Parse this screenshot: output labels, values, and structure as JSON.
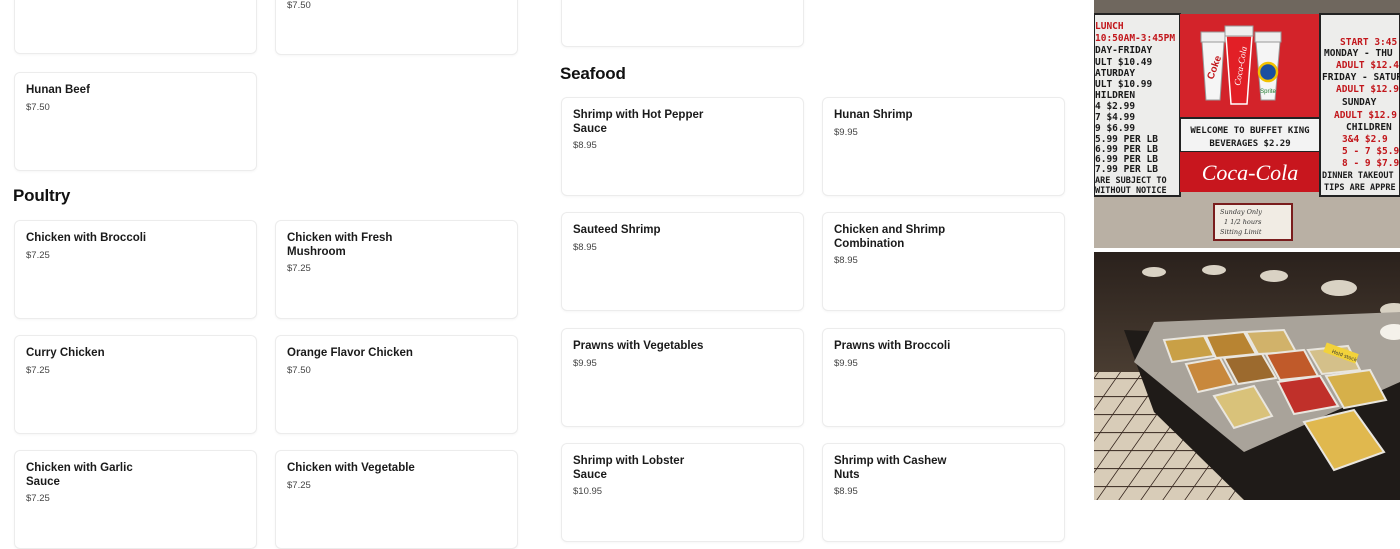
{
  "sections": {
    "poultry_title": "Poultry",
    "seafood_title": "Seafood"
  },
  "beef_items": [
    {
      "name": "",
      "price": ""
    },
    {
      "name": "",
      "price": "$7.50"
    },
    {
      "name": "Hunan Beef",
      "price": "$7.50"
    }
  ],
  "poultry_items": [
    {
      "name": "Chicken with Broccoli",
      "price": "$7.25"
    },
    {
      "name": "Chicken with Fresh Mushroom",
      "price": "$7.25"
    },
    {
      "name": "Curry Chicken",
      "price": "$7.25"
    },
    {
      "name": "Orange Flavor Chicken",
      "price": "$7.50"
    },
    {
      "name": "Chicken with Garlic Sauce",
      "price": "$7.25"
    },
    {
      "name": "Chicken with Vegetable",
      "price": "$7.25"
    }
  ],
  "seafood_items": [
    {
      "name": "Shrimp with Hot Pepper Sauce",
      "price": "$8.95"
    },
    {
      "name": "Hunan Shrimp",
      "price": "$9.95"
    },
    {
      "name": "Sauteed Shrimp",
      "price": "$8.95"
    },
    {
      "name": "Chicken and Shrimp Combination",
      "price": "$8.95"
    },
    {
      "name": "Prawns with Vegetables",
      "price": "$9.95"
    },
    {
      "name": "Prawns with Broccoli",
      "price": "$9.95"
    },
    {
      "name": "Shrimp with Lobster Sauce",
      "price": "$10.95"
    },
    {
      "name": "Shrimp with Cashew Nuts",
      "price": "$8.95"
    }
  ],
  "photos": {
    "menu_board": {
      "left_panel": [
        "LUNCH",
        "10:50AM-3:45PM",
        "DAY-FRIDAY",
        "ULT $10.49",
        "ATURDAY",
        "ULT $10.99",
        "HILDREN",
        "4 $2.99",
        "7 $4.99",
        "9 $6.99",
        "5.99 PER LB",
        "6.99 PER LB",
        "6.99 PER LB",
        "7.99 PER LB",
        "ARE SUBJECT TO",
        "WITHOUT NOTICE"
      ],
      "welcome_line": "WELCOME TO BUFFET KING",
      "beverages_line": "BEVERAGES $2.29",
      "coke_logo": "Coca-Cola",
      "cup_labels": [
        "Coke",
        "Coca-Cola",
        "Sprite"
      ],
      "note_lines": [
        "Sunday Only",
        "1 1/2 hours",
        "Sitting Limit"
      ],
      "right_panel": [
        "START 3:45",
        "MONDAY - THU",
        "ADULT $12.4",
        "FRIDAY - SATUR",
        "ADULT $12.9",
        "SUNDAY",
        "ADULT $12.9",
        "CHILDREN",
        "3&4 $2.9",
        "5 - 7 $5.9",
        "8 - 9 $7.9",
        "DINNER TAKEOUT",
        "TIPS ARE APPRE"
      ]
    },
    "buffet": {
      "sign": "Hold stock"
    }
  },
  "colors": {
    "card_border": "#ececec",
    "text": "#1a1a1a",
    "price": "#444444",
    "coke_red": "#c2161b"
  }
}
